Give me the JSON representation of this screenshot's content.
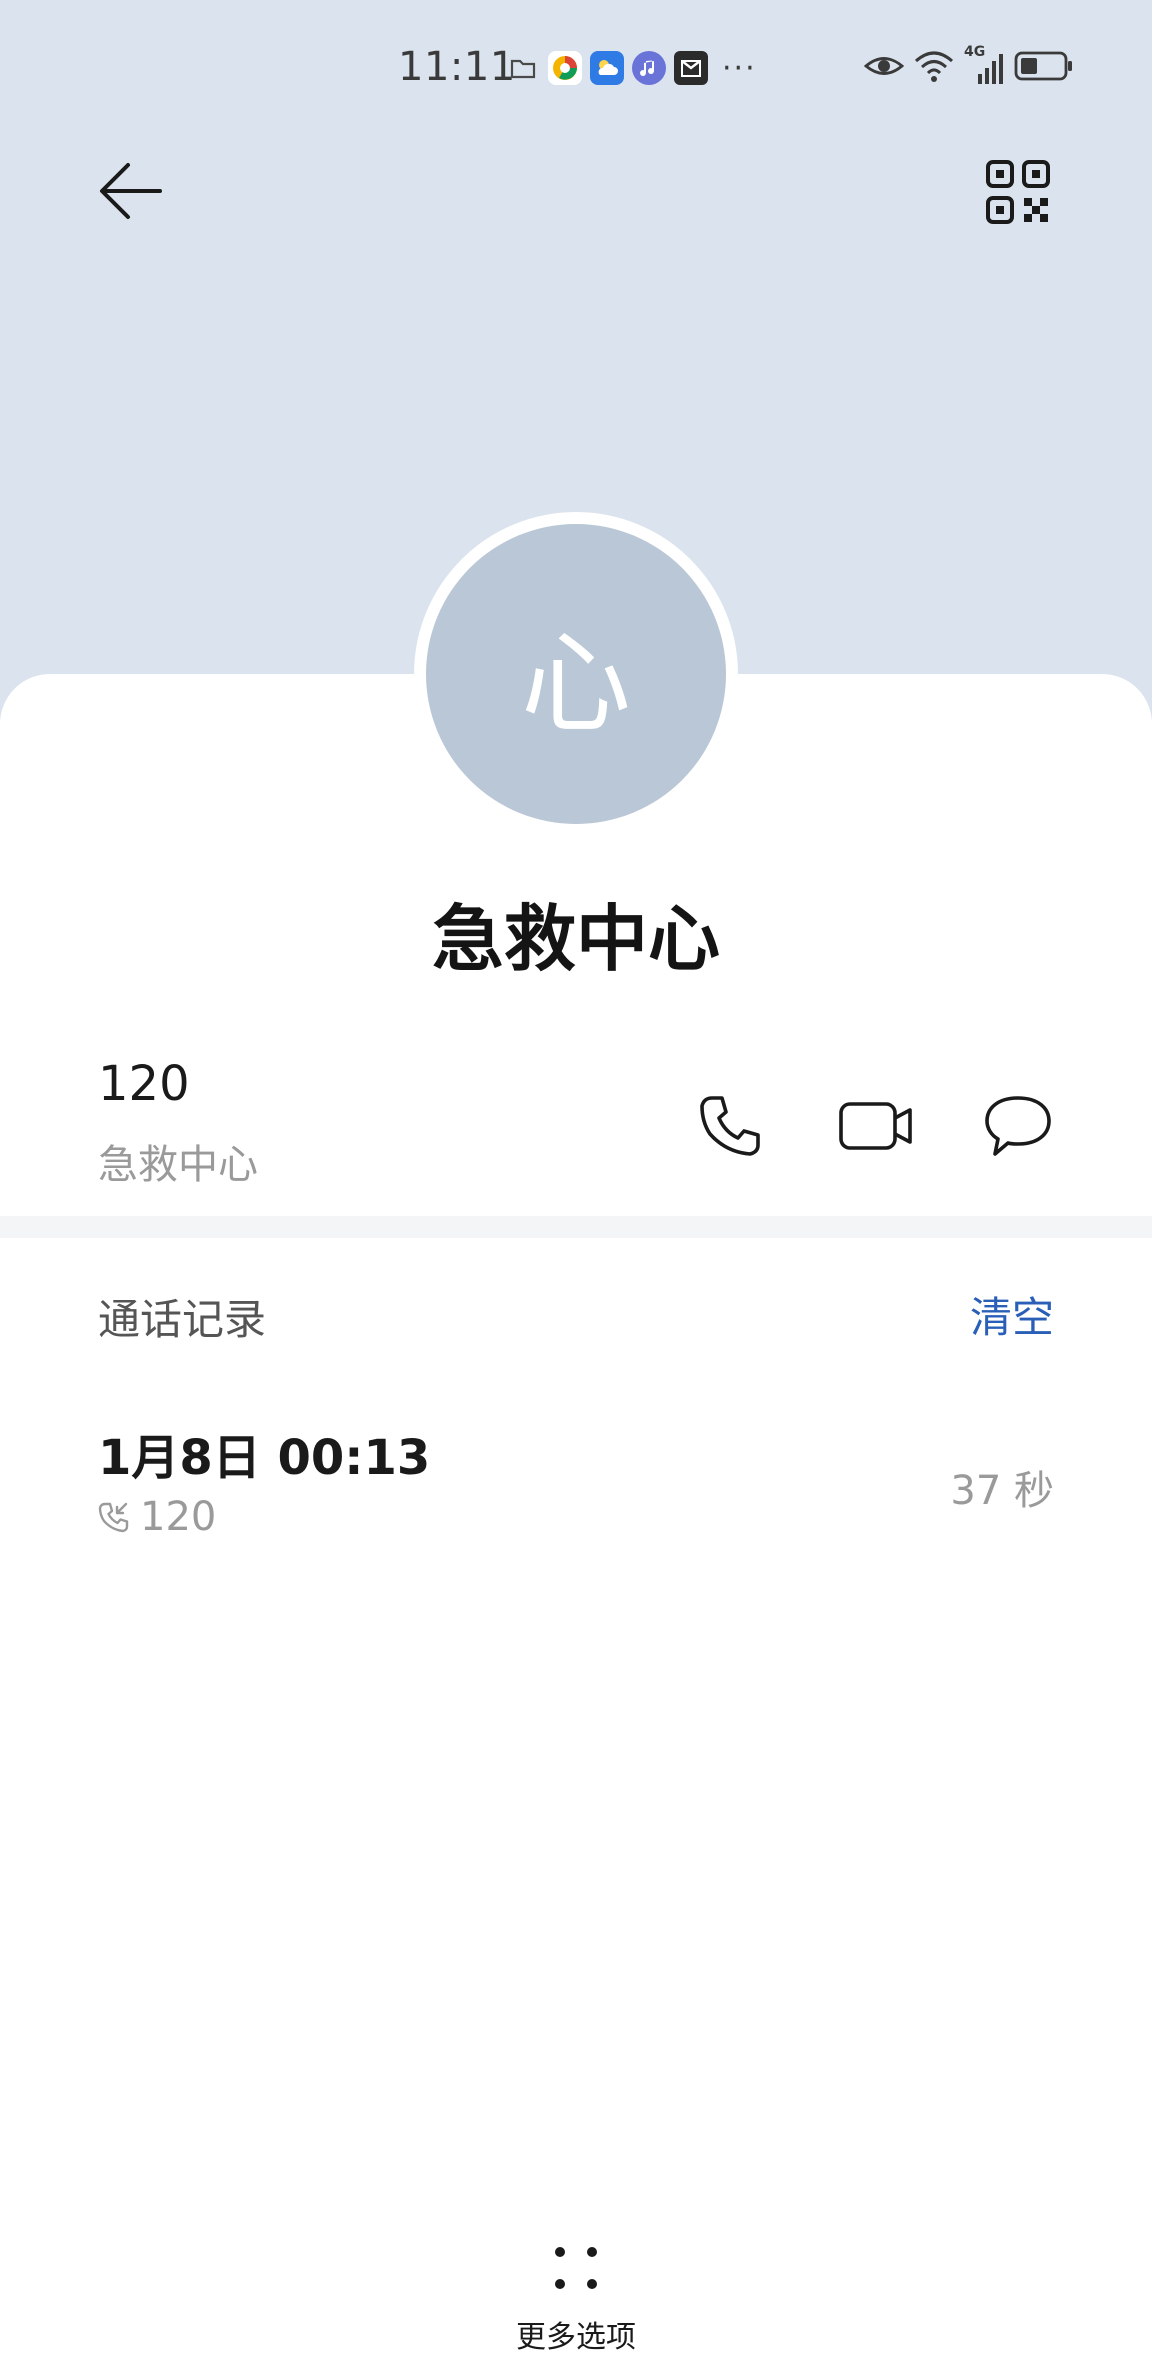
{
  "status_bar": {
    "time": "11:11",
    "dots": "···",
    "network_label": "4G"
  },
  "contact": {
    "avatar_letter": "心",
    "name": "急救中心",
    "number": "120",
    "number_label": "急救中心"
  },
  "call_log": {
    "title": "通话记录",
    "clear_label": "清空",
    "items": [
      {
        "datetime": "1月8日 00:13",
        "number": "120",
        "duration": "37 秒"
      }
    ]
  },
  "bottom": {
    "more_label": "更多选项"
  },
  "colors": {
    "header_bg": "#dbe4ee",
    "avatar_bg": "#b9c7d6",
    "accent": "#2a5fb8"
  }
}
